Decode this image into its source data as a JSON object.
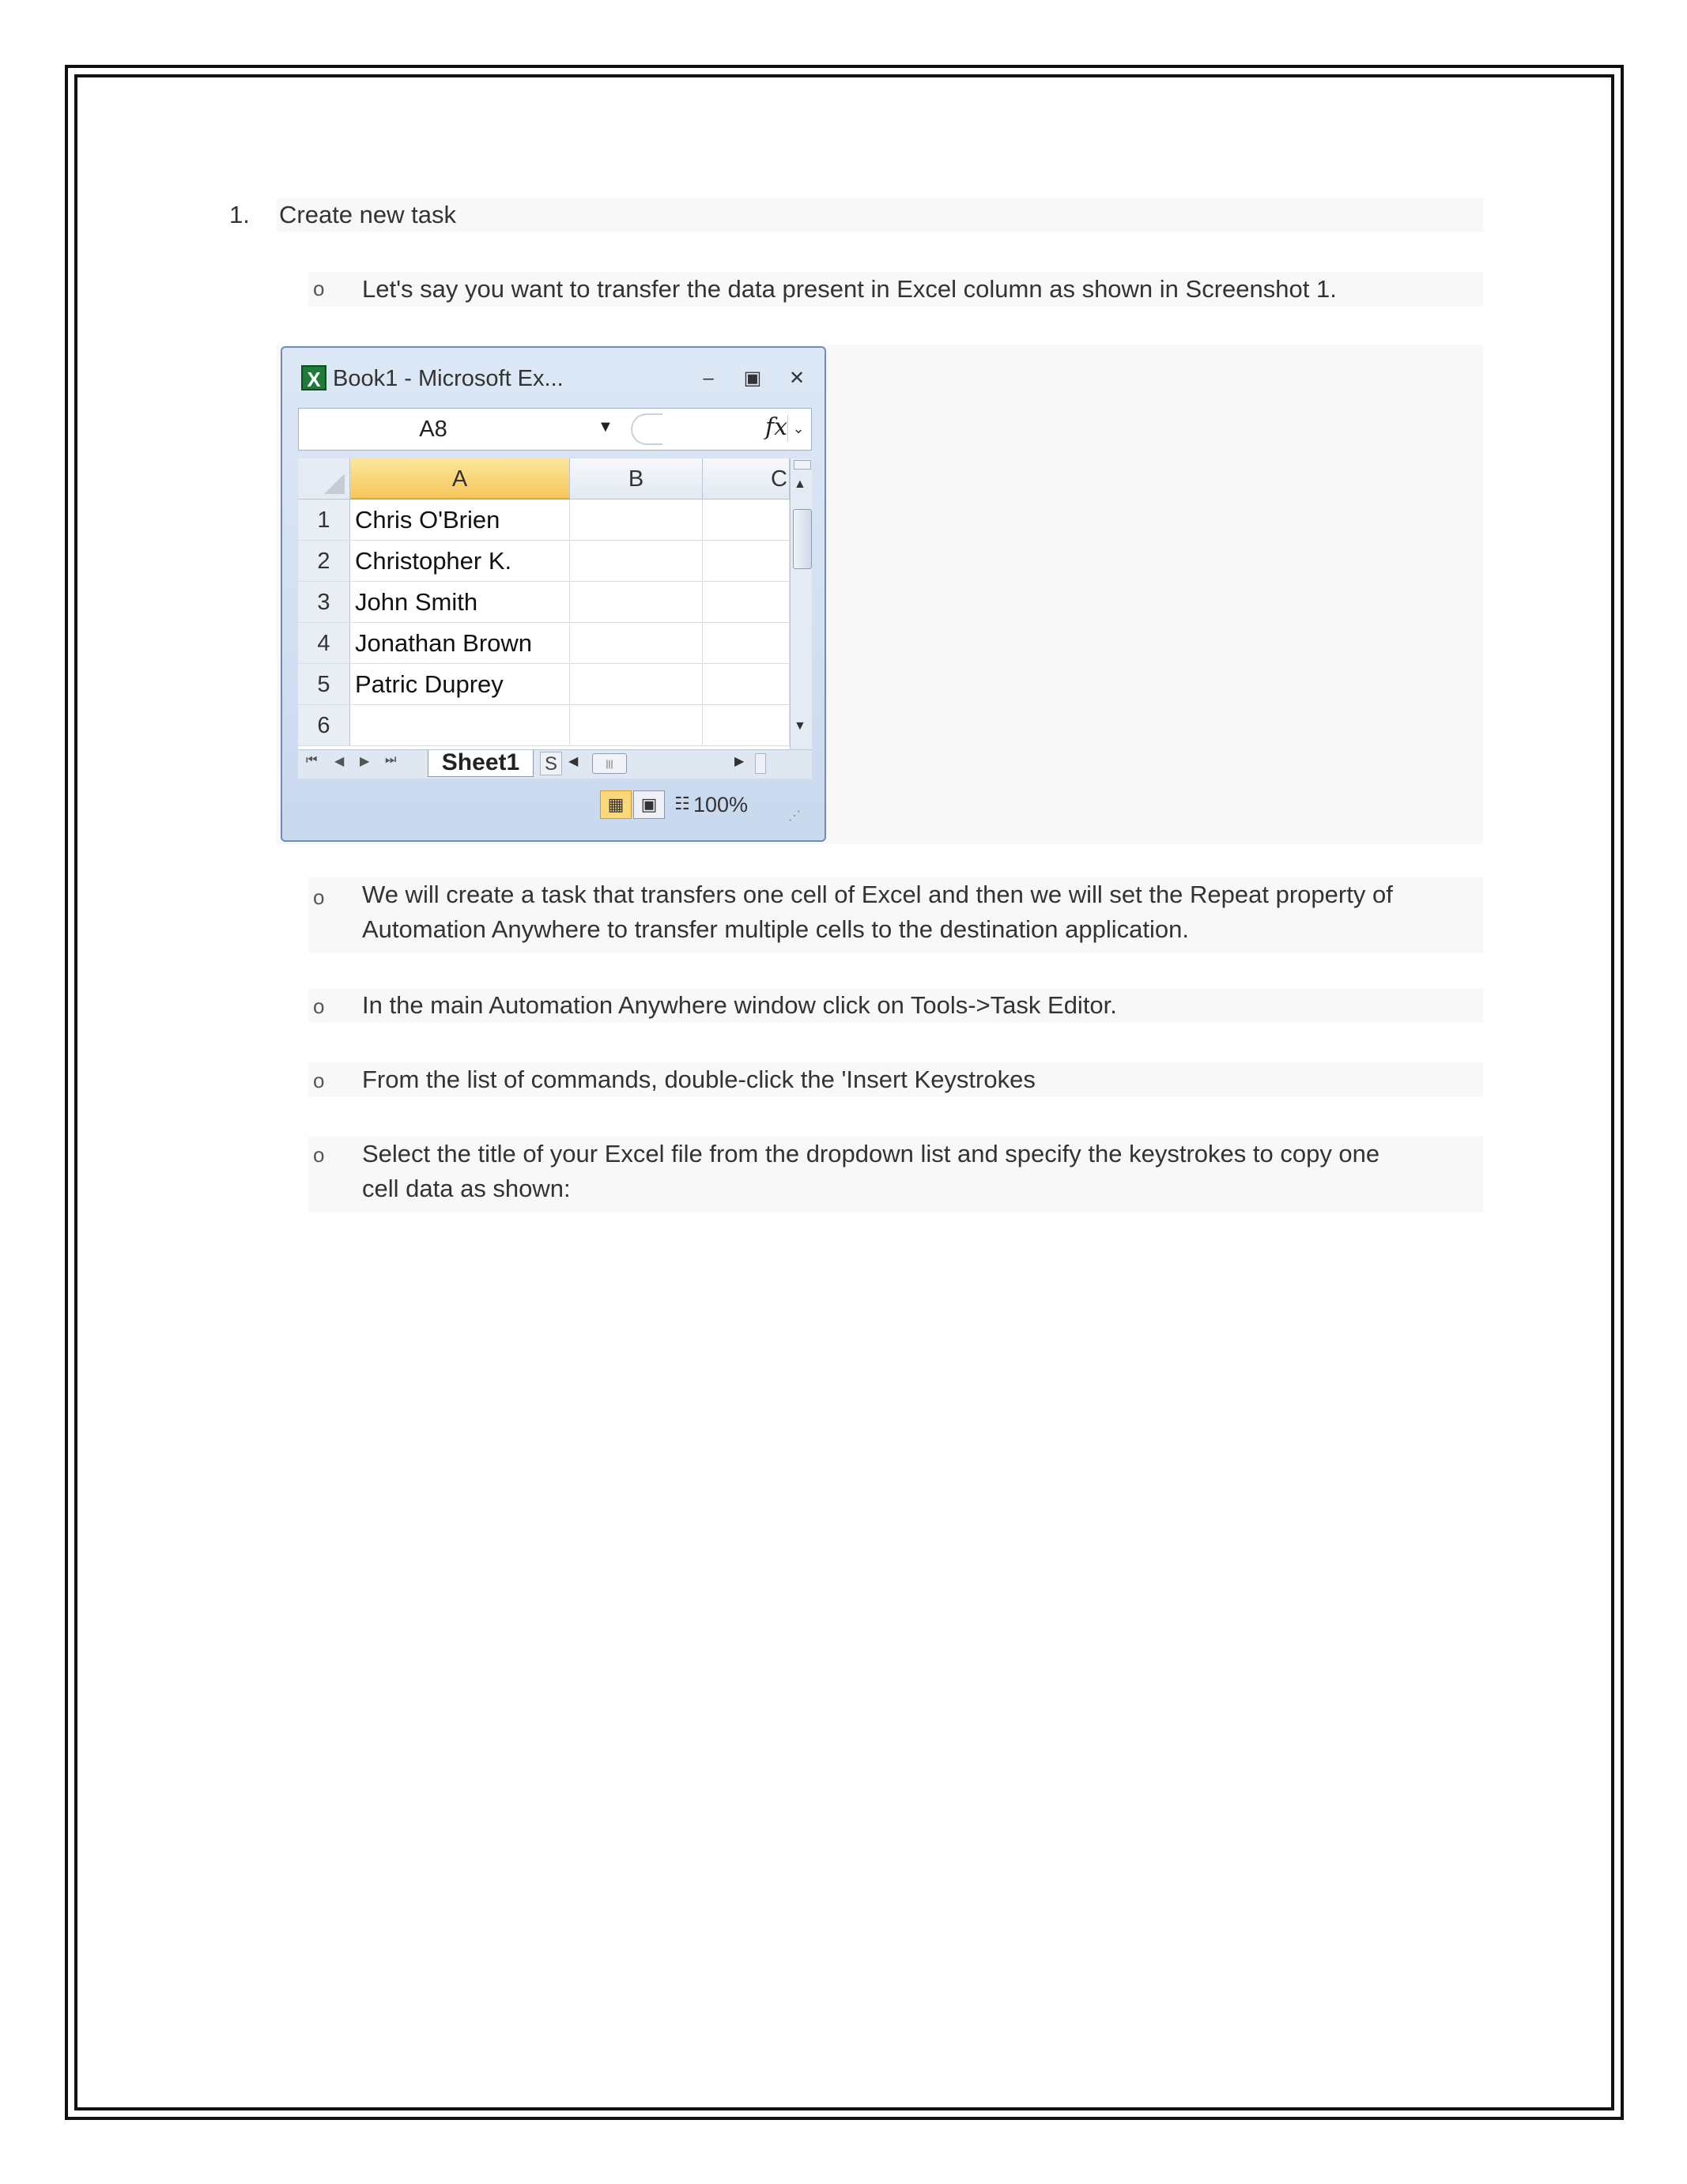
{
  "step": {
    "number": "1.",
    "text": "Create new task"
  },
  "intro_bullet": {
    "marker": "o",
    "text": "Let's say you want to transfer the data present in Excel column as shown in Screenshot 1."
  },
  "excel": {
    "title": "Book1 - Microsoft Ex...",
    "name_box": "A8",
    "fx_label": "fx",
    "columns": [
      "A",
      "B",
      "C"
    ],
    "rows": [
      {
        "num": "1",
        "a": "Chris O'Brien"
      },
      {
        "num": "2",
        "a": "Christopher K."
      },
      {
        "num": "3",
        "a": "John Smith"
      },
      {
        "num": "4",
        "a": "Jonathan Brown"
      },
      {
        "num": "5",
        "a": "Patric Duprey"
      },
      {
        "num": "6",
        "a": ""
      }
    ],
    "sheet_tab": "Sheet1",
    "next_tab_partial": "S",
    "zoom": "100%"
  },
  "bullets": [
    {
      "marker": "o",
      "line1": "We will create a task that transfers one cell of Excel and then we will set the Repeat property of",
      "line2": "Automation Anywhere to transfer multiple cells to the destination application."
    },
    {
      "marker": "o",
      "line1": "In the main Automation Anywhere window click on Tools->Task Editor.",
      "line2": ""
    },
    {
      "marker": "o",
      "line1": "From the list of commands, double-click the 'Insert Keystrokes",
      "line2": ""
    },
    {
      "marker": "o",
      "line1": "Select the title of your Excel file from the dropdown list and specify the keystrokes to copy one",
      "line2": "cell data as shown:"
    }
  ]
}
